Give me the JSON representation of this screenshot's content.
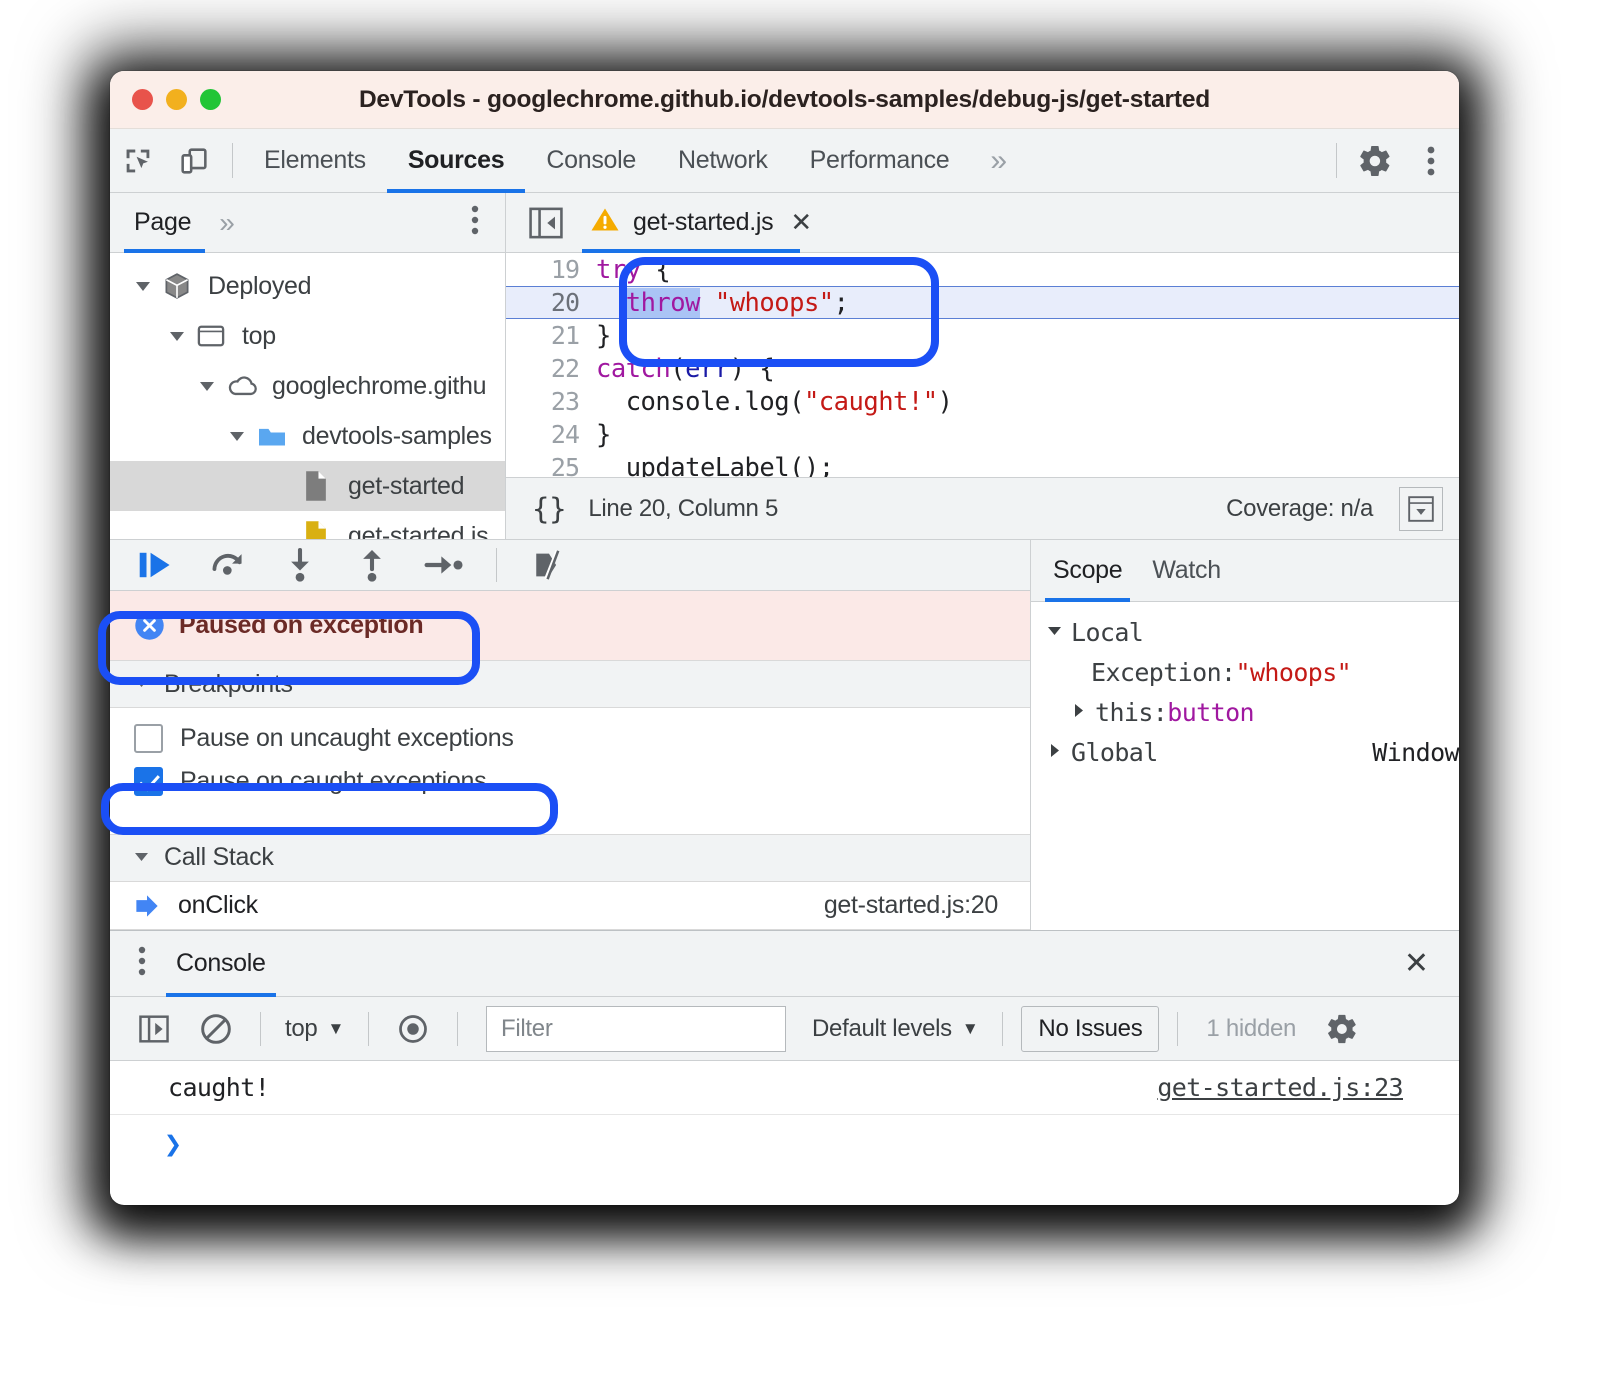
{
  "window": {
    "title": "DevTools - googlechrome.github.io/devtools-samples/debug-js/get-started",
    "traffic_lights": [
      "close",
      "minimize",
      "zoom"
    ]
  },
  "main_toolbar": {
    "icons": [
      "inspect-element-icon",
      "device-toolbar-icon"
    ],
    "tabs": [
      {
        "label": "Elements",
        "active": false
      },
      {
        "label": "Sources",
        "active": true
      },
      {
        "label": "Console",
        "active": false
      },
      {
        "label": "Network",
        "active": false
      },
      {
        "label": "Performance",
        "active": false
      }
    ],
    "overflow": "»",
    "settings_icon": "gear-icon",
    "kebab_icon": "more-vertical-icon"
  },
  "navigator": {
    "tab_label": "Page",
    "overflow": "»",
    "kebab_icon": "more-vertical-icon",
    "tree": [
      {
        "label": "Deployed",
        "icon": "cube-icon",
        "depth": 0,
        "expanded": true,
        "selected": false
      },
      {
        "label": "top",
        "icon": "frame-icon",
        "depth": 1,
        "expanded": true,
        "selected": false
      },
      {
        "label": "googlechrome.githu",
        "icon": "cloud-icon",
        "depth": 2,
        "expanded": true,
        "selected": false
      },
      {
        "label": "devtools-samples",
        "icon": "folder-icon",
        "depth": 3,
        "expanded": true,
        "selected": false
      },
      {
        "label": "get-started",
        "icon": "document-grey-icon",
        "depth": 4,
        "expanded": null,
        "selected": true
      },
      {
        "label": "get-started.js",
        "icon": "document-yellow-icon",
        "depth": 4,
        "expanded": null,
        "selected": false
      }
    ]
  },
  "editor": {
    "panel_toggle_icon": "show-navigator-icon",
    "tab": {
      "label": "get-started.js",
      "warning_icon": "warning-triangle-icon",
      "close_icon": "close-icon"
    },
    "lines": [
      {
        "num": "19",
        "highlight": false,
        "tokens": [
          {
            "t": "try",
            "c": "kw"
          },
          {
            "t": " {",
            "c": ""
          }
        ],
        "indent": 0
      },
      {
        "num": "20",
        "highlight": true,
        "tokens": [
          {
            "t": "throw",
            "c": "kw-sel"
          },
          {
            "t": " ",
            "c": ""
          },
          {
            "t": "\"whoops\"",
            "c": "str"
          },
          {
            "t": ";",
            "c": ""
          }
        ],
        "indent": 2
      },
      {
        "num": "21",
        "highlight": false,
        "tokens": [
          {
            "t": "}",
            "c": ""
          }
        ],
        "indent": 0
      },
      {
        "num": "22",
        "highlight": false,
        "tokens": [
          {
            "t": "catch",
            "c": "kw"
          },
          {
            "t": "(",
            "c": ""
          },
          {
            "t": "err",
            "c": "var"
          },
          {
            "t": ") {",
            "c": ""
          }
        ],
        "indent": 0
      },
      {
        "num": "23",
        "highlight": false,
        "tokens": [
          {
            "t": "console.log(",
            "c": ""
          },
          {
            "t": "\"caught!\"",
            "c": "str"
          },
          {
            "t": ")",
            "c": ""
          }
        ],
        "indent": 2
      },
      {
        "num": "24",
        "highlight": false,
        "tokens": [
          {
            "t": "}",
            "c": ""
          }
        ],
        "indent": 0
      },
      {
        "num": "25",
        "highlight": false,
        "tokens": [
          {
            "t": "updateLabel();",
            "c": ""
          }
        ],
        "indent": 0
      }
    ],
    "status": {
      "pretty_print_icon": "{}",
      "position": "Line 20, Column 5",
      "coverage": "Coverage: n/a",
      "coverage_button_icon": "drawer-toggle-icon"
    }
  },
  "debugger": {
    "toolbar_buttons": [
      "resume-script-execution-icon",
      "step-over-icon",
      "step-into-icon",
      "step-out-icon",
      "step-icon",
      "deactivate-breakpoints-icon"
    ],
    "paused_banner": {
      "icon": "pause-exception-icon",
      "text": "Paused on exception"
    },
    "breakpoints": {
      "header": "Breakpoints",
      "expanded": true,
      "options": [
        {
          "label": "Pause on uncaught exceptions",
          "checked": false
        },
        {
          "label": "Pause on caught exceptions",
          "checked": true
        }
      ]
    },
    "call_stack": {
      "header": "Call Stack",
      "expanded": true,
      "frames": [
        {
          "icon": "current-frame-arrow-icon",
          "name": "onClick",
          "location": "get-started.js:20"
        }
      ]
    }
  },
  "scope_pane": {
    "tabs": [
      {
        "label": "Scope",
        "active": true
      },
      {
        "label": "Watch",
        "active": false
      }
    ],
    "rows": [
      {
        "expander": "down",
        "indent": 0,
        "key": "Local",
        "value": "",
        "value_class": "",
        "right": ""
      },
      {
        "expander": "none",
        "indent": 1,
        "key": "Exception: ",
        "value": "\"whoops\"",
        "value_class": "sval-str",
        "right": ""
      },
      {
        "expander": "right",
        "indent": 0,
        "key": "this: ",
        "value": "button",
        "value_class": "sval-obj",
        "right": ""
      },
      {
        "expander": "right",
        "indent": 0,
        "key": "Global",
        "value": "",
        "value_class": "",
        "right": "Window"
      }
    ]
  },
  "drawer": {
    "kebab_icon": "more-vertical-icon",
    "tab_label": "Console",
    "close_icon": "close-icon",
    "toolbar": {
      "sidebar_icon": "console-sidebar-icon",
      "clear_icon": "clear-console-icon",
      "context_selector": "top",
      "context_caret": "▼",
      "eye_icon": "live-expression-icon",
      "filter_placeholder": "Filter",
      "levels_label": "Default levels",
      "levels_caret": "▼",
      "issues_label": "No Issues",
      "hidden_label": "1 hidden",
      "settings_icon": "gear-icon"
    },
    "messages": [
      {
        "text": "caught!",
        "source": "get-started.js:23"
      }
    ],
    "prompt_caret": "❯"
  },
  "annotations": {
    "color": "#1b4ff5",
    "highlighted_regions": [
      "try-throw-block",
      "paused-on-exception-banner",
      "pause-on-caught-exceptions-checkbox"
    ]
  },
  "colors": {
    "accent": "#1a73e8",
    "annotation": "#1b4ff5",
    "paused_bg": "#fbe9e7",
    "paused_text": "#6b2a26",
    "titlebar_bg": "#fbeee9",
    "string": "#c41a16",
    "keyword": "#a018a0"
  }
}
